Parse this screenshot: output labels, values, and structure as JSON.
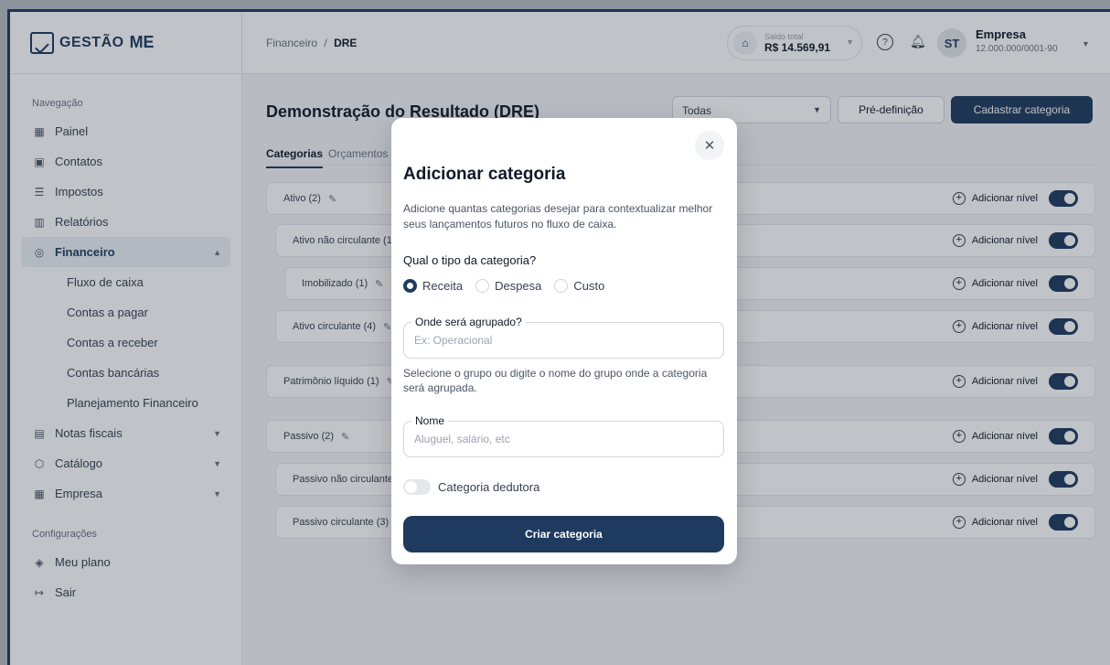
{
  "brand": {
    "name": "GESTÃO",
    "suffix": "ME"
  },
  "sidebar": {
    "nav_label": "Navegação",
    "items": [
      {
        "label": "Painel",
        "icon": "grid-icon"
      },
      {
        "label": "Contatos",
        "icon": "contacts-icon"
      },
      {
        "label": "Impostos",
        "icon": "receipt-icon"
      },
      {
        "label": "Relatórios",
        "icon": "chart-icon"
      },
      {
        "label": "Financeiro",
        "icon": "finance-icon"
      },
      {
        "label": "Notas fiscais",
        "icon": "invoice-icon"
      },
      {
        "label": "Catálogo",
        "icon": "box-icon"
      },
      {
        "label": "Empresa",
        "icon": "building-icon"
      }
    ],
    "financeiro_sub": [
      "Fluxo de caixa",
      "Contas a pagar",
      "Contas a receber",
      "Contas bancárias",
      "Planejamento Financeiro"
    ],
    "config_label": "Configurações",
    "config_items": [
      {
        "label": "Meu plano",
        "icon": "layers-icon"
      },
      {
        "label": "Sair",
        "icon": "logout-icon"
      }
    ]
  },
  "header": {
    "breadcrumb_parent": "Financeiro",
    "breadcrumb_sep": "/",
    "breadcrumb_current": "DRE",
    "saldo_label": "Saldo total",
    "saldo_value": "R$ 14.569,91",
    "avatar_initials": "ST",
    "company_name": "Empresa",
    "company_cnpj": "12.000.000/0001-90"
  },
  "main": {
    "title": "Demonstração do Resultado (DRE)",
    "filter_value": "Todas",
    "btn_predefinicao": "Pré-definição",
    "btn_cadastrar": "Cadastrar categoria",
    "tabs": [
      "Categorias",
      "Orçamentos"
    ],
    "add_level_label": "Adicionar nível",
    "rows": [
      {
        "label": "Ativo (2)"
      },
      {
        "label": "Ativo não circulante (1)"
      },
      {
        "label": "Imobilizado (1)"
      },
      {
        "label": "Ativo circulante (4)"
      },
      {
        "label": "Patrimônio líquido (1)"
      },
      {
        "label": "Passivo (2)"
      },
      {
        "label": "Passivo não circulante"
      },
      {
        "label": "Passivo circulante (3)"
      }
    ]
  },
  "modal": {
    "title": "Adicionar categoria",
    "description": "Adicione quantas categorias desejar para contextualizar melhor seus lançamentos futuros no fluxo de caixa.",
    "question": "Qual o tipo da categoria?",
    "options": [
      "Receita",
      "Despesa",
      "Custo"
    ],
    "selected_option": "Receita",
    "group_label": "Onde será agrupado?",
    "group_placeholder": "Ex: Operacional",
    "group_help": "Selecione o grupo ou digite o nome do grupo onde a categoria será agrupada.",
    "name_label": "Nome",
    "name_placeholder": "Aluguel, salário, etc",
    "deductor_label": "Categoria dedutora",
    "submit_label": "Criar categoria"
  }
}
